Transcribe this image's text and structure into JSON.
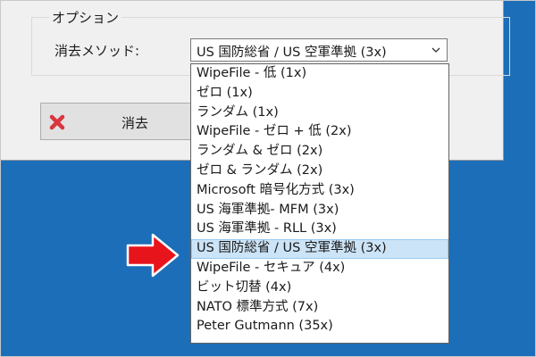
{
  "dialog": {
    "group_title": "オプション",
    "method_label": "消去メソッド:",
    "combo_value": "US 国防総省 / US 空軍準拠 (3x)",
    "erase_button": "消去"
  },
  "dropdown": {
    "options": [
      "WipeFile - 低 (1x)",
      "ゼロ (1x)",
      "ランダム (1x)",
      "WipeFile - ゼロ + 低 (2x)",
      "ランダム & ゼロ (2x)",
      "ゼロ & ランダム (2x)",
      "Microsoft 暗号化方式 (3x)",
      "US 海軍準拠- MFM (3x)",
      "US 海軍準拠 - RLL (3x)",
      "US 国防総省 / US 空軍準拠 (3x)",
      "WipeFile - セキュア (4x)",
      "ビット切替 (4x)",
      "NATO 標準方式 (7x)",
      "Peter Gutmann (35x)"
    ],
    "selected_index": 9
  },
  "colors": {
    "desktop": "#1c6eb8",
    "dialog": "#f0f0f0",
    "selection": "#cce4f7",
    "pointer_arrow": "#e8141c",
    "erase_icon": "#d9363e"
  },
  "icons": {
    "combo_arrow": "chevron-down-icon",
    "erase_button": "delete-x-icon",
    "pointer": "red-arrow-icon"
  }
}
